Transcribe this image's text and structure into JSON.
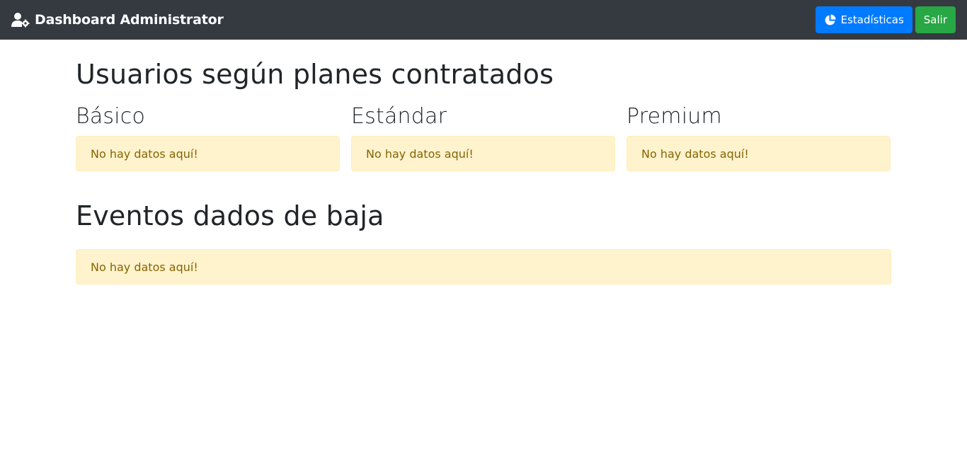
{
  "navbar": {
    "brand_icon": "user-gear-icon",
    "brand": "Dashboard Administrator",
    "stats_icon": "pie-chart-icon",
    "stats_label": "Estadísticas",
    "logout_label": "Salir",
    "colors": {
      "navbar_bg": "#343a40",
      "primary": "#007bff",
      "success": "#28a745"
    }
  },
  "main": {
    "title": "Usuarios según planes contratados",
    "plans": [
      {
        "name": "Básico",
        "message": "No hay datos aquí!"
      },
      {
        "name": "Estándar",
        "message": "No hay datos aquí!"
      },
      {
        "name": "Premium",
        "message": "No hay datos aquí!"
      }
    ],
    "events_title": "Eventos dados de baja",
    "events_message": "No hay datos aquí!",
    "alert_colors": {
      "background": "#fff3cd",
      "text": "#856404"
    }
  }
}
